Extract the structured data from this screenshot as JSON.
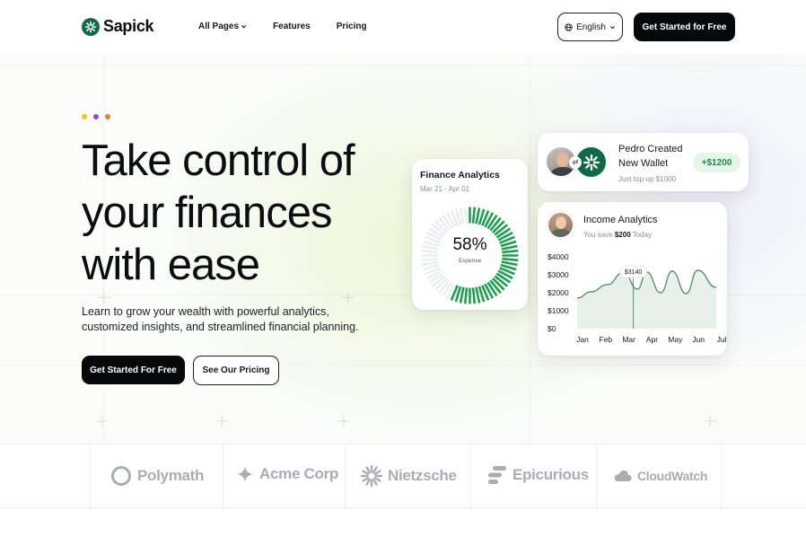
{
  "brand": {
    "name": "Sapick",
    "color": "#0f6b46"
  },
  "nav": {
    "items": [
      {
        "label": "All Pages",
        "has_dropdown": true
      },
      {
        "label": "Features"
      },
      {
        "label": "Pricing"
      }
    ]
  },
  "language": {
    "label": "English"
  },
  "header_cta": "Get Started for Free",
  "hero": {
    "dots": [
      "#f2c318",
      "#9b42d8",
      "#ef7d2b"
    ],
    "title_lines": [
      "Take control of",
      "your finances",
      "with ease"
    ],
    "subtitle_lines": [
      "Learn to grow your wealth with powerful analytics,",
      "customized insights, and streamlined financial planning."
    ],
    "primary_cta": "Get Started For Free",
    "secondary_cta": "See Our Pricing"
  },
  "finance_card": {
    "title": "Finance Analytics",
    "date_range": "Mar 21 - Apr 01",
    "percent_label": "58%",
    "percent_value": 58,
    "caption": "Expense",
    "accent": "#1e9f4f"
  },
  "wallet_card": {
    "title_lines": [
      "Pedro Created",
      "New Wallet"
    ],
    "subtitle": "Just top-up $1000",
    "amount": "+$1200"
  },
  "income_card": {
    "title": "Income Analytics",
    "save_prefix": "You save",
    "save_amount": "$200",
    "save_suffix": "Today"
  },
  "chart_data": {
    "type": "area",
    "x": [
      "Jan",
      "Feb",
      "Mar",
      "Apr",
      "May",
      "Jun",
      "Jul"
    ],
    "y_ticks": [
      "$4000",
      "$3000",
      "$2000",
      "$1000",
      "$0"
    ],
    "ylim": [
      0,
      4000
    ],
    "series": [
      {
        "values": [
          1700,
          2050,
          2450,
          3140,
          2200,
          3150,
          2000,
          3200,
          1950,
          3250,
          2300
        ]
      }
    ],
    "sample_x": [
      0,
      0.6,
      1.3,
      2.0,
      2.6,
      3.0,
      3.6,
      4.1,
      4.7,
      5.2,
      6.0
    ],
    "highlight": {
      "label": "$3140",
      "x_index": 2.5
    },
    "line_color": "#5c8f74",
    "fill_color": "#e8f0ea"
  },
  "logos": [
    {
      "name": "Polymath",
      "icon": "ring-icon"
    },
    {
      "name": "Acme Corp",
      "icon": "sparkle-icon"
    },
    {
      "name": "Nietzsche",
      "icon": "sunburst-icon"
    },
    {
      "name": "Epicurious",
      "icon": "stack-icon"
    },
    {
      "name": "CloudWatch",
      "icon": "cloud-icon"
    }
  ]
}
